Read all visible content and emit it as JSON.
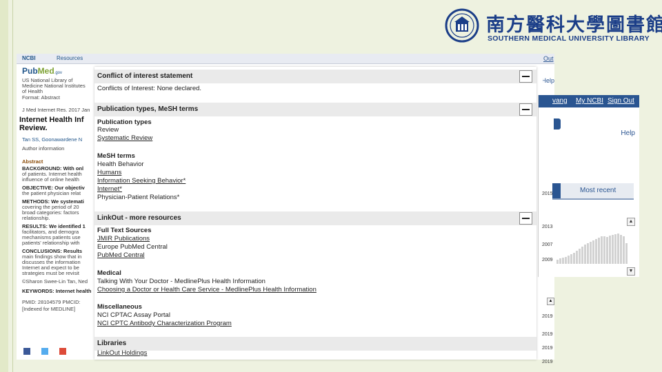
{
  "library": {
    "cn_name": "南方醫科大學圖書館",
    "en_name": "SOUTHERN MEDICAL UNIVERSITY LIBRARY"
  },
  "background_page": {
    "ncbi": "NCBI",
    "resources": "Resources",
    "pubmed_logo_a": "Pub",
    "pubmed_logo_b": "Med",
    "pubmed_logo_gov": ".gov",
    "nlm_1": "US National Library of",
    "nlm_2": "Medicine National Institutes",
    "nlm_3": "of Health",
    "format": "Format: Abstract",
    "citation": "J Med Internet Res. 2017 Jan",
    "title_1": "Internet Health Inf",
    "title_2": "Review.",
    "authors": "Tan SS, Goonawardene N",
    "author_info": "Author information",
    "abstract": "Abstract",
    "lines": [
      {
        "text": "BACKGROUND: With onl",
        "style": "b"
      },
      {
        "text": "of patients. Internet health",
        "style": ""
      },
      {
        "text": "influence of online health",
        "style": ""
      },
      {
        "text": "OBJECTIVE: Our objectiv",
        "style": "b"
      },
      {
        "text": "the patient physician relat",
        "style": ""
      },
      {
        "text": "METHODS: We systemati",
        "style": "b"
      },
      {
        "text": "covering the period of 20",
        "style": ""
      },
      {
        "text": "broad categories: factors",
        "style": ""
      },
      {
        "text": "relationship.",
        "style": ""
      },
      {
        "text": "RESULTS: We identified 1",
        "style": "b"
      },
      {
        "text": "facilitators, and demogra",
        "style": ""
      },
      {
        "text": "mechanisms patients use",
        "style": ""
      },
      {
        "text": "patients' relationship with",
        "style": ""
      },
      {
        "text": "CONCLUSIONS: Results",
        "style": "b"
      },
      {
        "text": "main findings show that in",
        "style": ""
      },
      {
        "text": "discusses the information",
        "style": ""
      },
      {
        "text": "Internet and expect to be",
        "style": ""
      },
      {
        "text": "strategies must be revisit",
        "style": ""
      },
      {
        "text": "©Sharon Swee-Lin Tan, Ned",
        "style": ""
      },
      {
        "text": "KEYWORDS: Internet health",
        "style": "b"
      },
      {
        "text": "PMID: 28104579   PMCID:",
        "style": ""
      },
      {
        "text": "[Indexed for MEDLINE]",
        "style": ""
      }
    ]
  },
  "right_panel": {
    "user": "vang",
    "my_ncbi": "My NCBI",
    "sign_out": "Sign Out",
    "out": "Out",
    "help_top": "Help",
    "help": "Help",
    "most_recent": "Most recent",
    "edge_texts": [
      "2015",
      "2013",
      "2007",
      "2009",
      "2019",
      "2019",
      "2019",
      "2019"
    ]
  },
  "overlay": {
    "sections": [
      {
        "title": "Conflict of interest statement"
      },
      {
        "title": "Publication types, MeSH terms"
      },
      {
        "title": "LinkOut - more resources"
      },
      {
        "title": "Libraries"
      }
    ],
    "coi_text": "Conflicts of Interest: None declared.",
    "pubtypes_heading": "Publication types",
    "pubtypes": [
      "Review",
      "Systematic Review"
    ],
    "mesh_heading": "MeSH terms",
    "mesh": [
      "Health Behavior",
      "Humans",
      "Information Seeking Behavior*",
      "Internet*",
      "Physician-Patient Relations*"
    ],
    "fulltext_heading": "Full Text Sources",
    "fulltext": [
      "JMIR Publications",
      "Europe PubMed Central",
      "PubMed Central"
    ],
    "medical_heading": "Medical",
    "medical": [
      "Talking With Your Doctor - MedlinePlus Health Information",
      "Choosing a Doctor or Health Care Service - MedlinePlus Health Information"
    ],
    "misc_heading": "Miscellaneous",
    "misc": [
      "NCI CPTAC Assay Portal",
      "NCI CPTC Antibody Characterization Program"
    ],
    "libraries": [
      "LinkOut Holdings"
    ]
  }
}
